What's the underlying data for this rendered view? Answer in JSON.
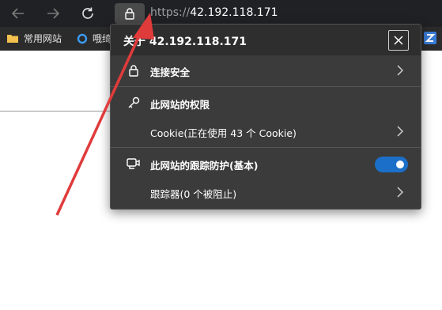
{
  "browser": {
    "url_scheme": "https://",
    "url_host": "42.192.118.171"
  },
  "bookmarks": [
    {
      "label": "常用网站"
    },
    {
      "label": "哦绮"
    }
  ],
  "popup": {
    "title": "关于 42.192.118.171",
    "connection_label": "连接安全",
    "permissions_label": "此网站的权限",
    "cookie_label": "Cookie(正在使用 43 个 Cookie)",
    "tracking_label": "此网站的跟踪防护(基本)",
    "tracking_enabled": true,
    "trackers_label": "跟踪器(0 个被阻止)"
  },
  "colors": {
    "toolbar": "#202124",
    "popup_bg": "#3b3b3b",
    "toggle_on": "#1c6fc9",
    "annotation_arrow": "#e03b3b"
  }
}
